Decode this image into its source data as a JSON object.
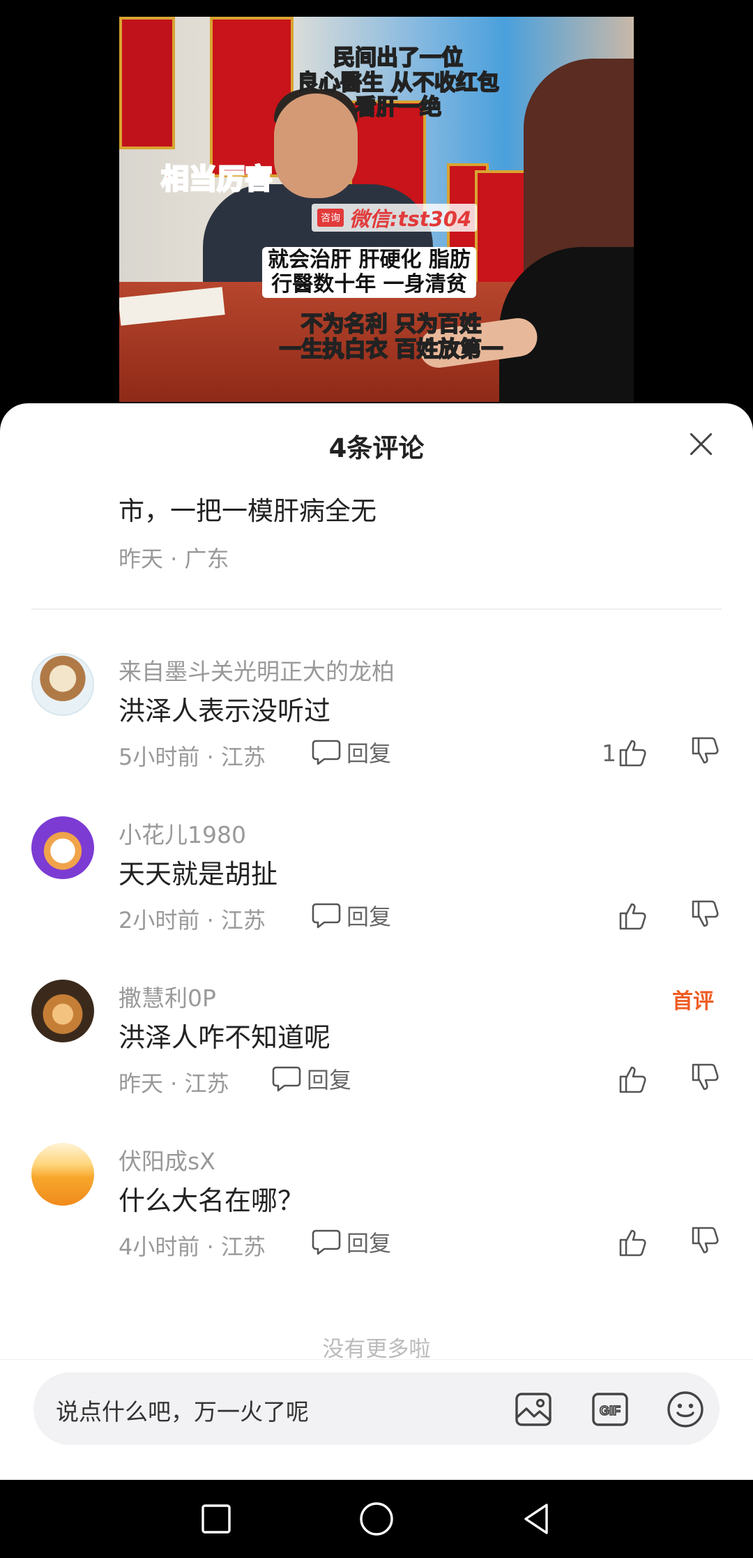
{
  "video": {
    "caption_top": [
      "民间出了一位",
      "良心醫生 从不收红包",
      "看肝一绝"
    ],
    "caption_red": "相当厉害",
    "wechat_badge": "咨询",
    "wechat_text": "微信:tst304",
    "caption_middle": [
      "就会治肝 肝硬化 脂肪",
      "行醫数十年 一身清贫"
    ],
    "caption_bottom": [
      "不为名利 只为百姓",
      "一生执白衣 百姓放第一"
    ]
  },
  "sheet": {
    "title": "4条评论",
    "partial_comment": {
      "text": "市，一把一模肝病全无",
      "meta": "昨天 · 广东"
    },
    "comments": [
      {
        "avatar": "bear-avatar",
        "username": "来自墨斗关光明正大的龙柏",
        "text": "洪泽人表示没听过",
        "meta": "5小时前 · 江苏",
        "reply_label": "回复",
        "like_count": "1",
        "badge": ""
      },
      {
        "avatar": "cat-avatar",
        "username": "小花儿1980",
        "text": "天天就是胡扯",
        "meta": "2小时前 · 江苏",
        "reply_label": "回复",
        "like_count": "",
        "badge": ""
      },
      {
        "avatar": "kitten-avatar",
        "username": "撒慧利0P",
        "text": "洪泽人咋不知道呢",
        "meta": "昨天 · 江苏",
        "reply_label": "回复",
        "like_count": "",
        "badge": "首评"
      },
      {
        "avatar": "sunset-avatar",
        "username": "伏阳成sX",
        "text": "什么大名在哪？",
        "meta": "4小时前 · 江苏",
        "reply_label": "回复",
        "like_count": "",
        "badge": ""
      }
    ],
    "no_more": "没有更多啦",
    "input_placeholder": "说点什么吧，万一火了呢",
    "icons": [
      "image-icon",
      "gif-icon",
      "emoji-icon"
    ]
  },
  "colors": {
    "accent": "#ef5d23",
    "meta_gray": "#999999"
  }
}
